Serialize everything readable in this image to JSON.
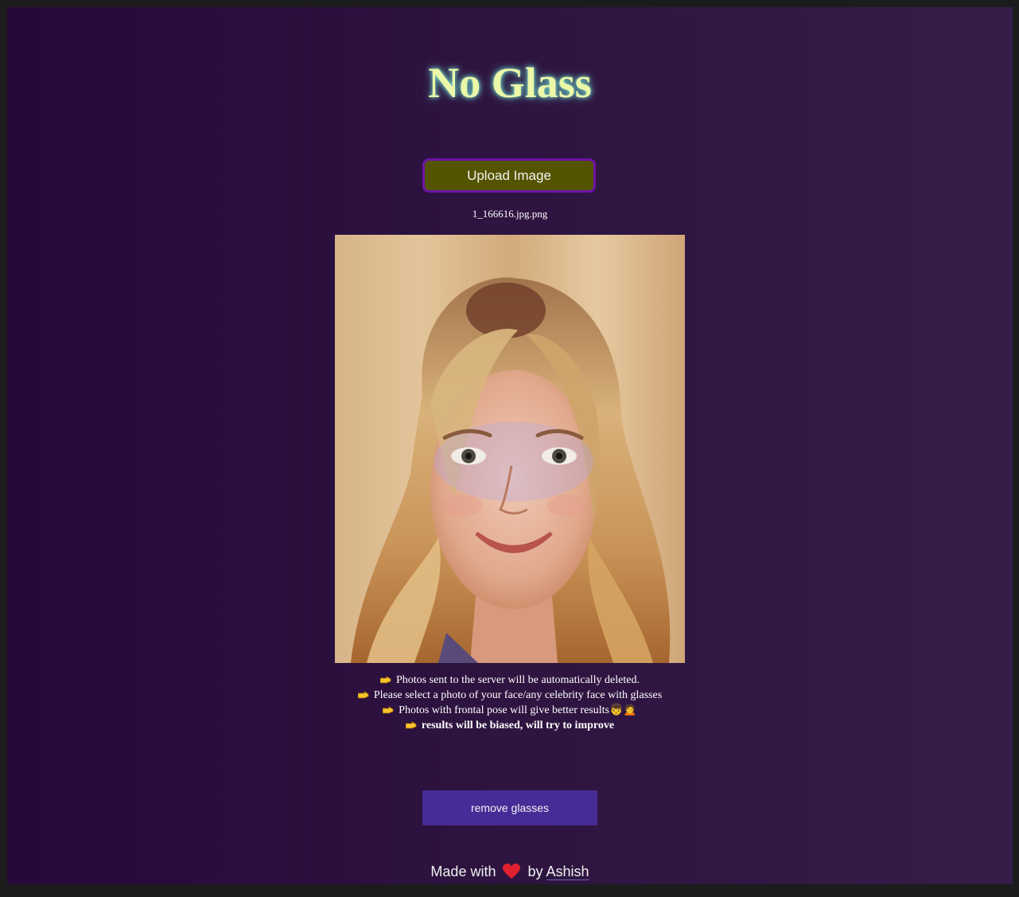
{
  "app": {
    "title": "No Glass"
  },
  "upload": {
    "button_label": "Upload Image",
    "filename": "1_166616.jpg.png"
  },
  "preview": {
    "image": "uploaded-face-photo"
  },
  "notes": [
    "Photos sent to the server will be automatically deleted.",
    "Please select a photo of your face/any celebrity face with glasses",
    "Photos with frontal pose will give better results👦🙍",
    "results will be biased, will try to improve"
  ],
  "icons": {
    "note_bullet": "pointing-hand-icon",
    "footer_heart": "heart-icon"
  },
  "action": {
    "remove_label": "remove glasses"
  },
  "footer": {
    "prefix": "Made with",
    "by": "by",
    "author": "Ashish"
  },
  "colors": {
    "background_start": "#26083a",
    "background_end": "#341d48",
    "title": "#ecf7a8",
    "title_glow": "#7df7e0",
    "upload_button": "#545400",
    "upload_border": "#6d12a8",
    "remove_button": "#462c96",
    "heart": "#e0202e"
  }
}
